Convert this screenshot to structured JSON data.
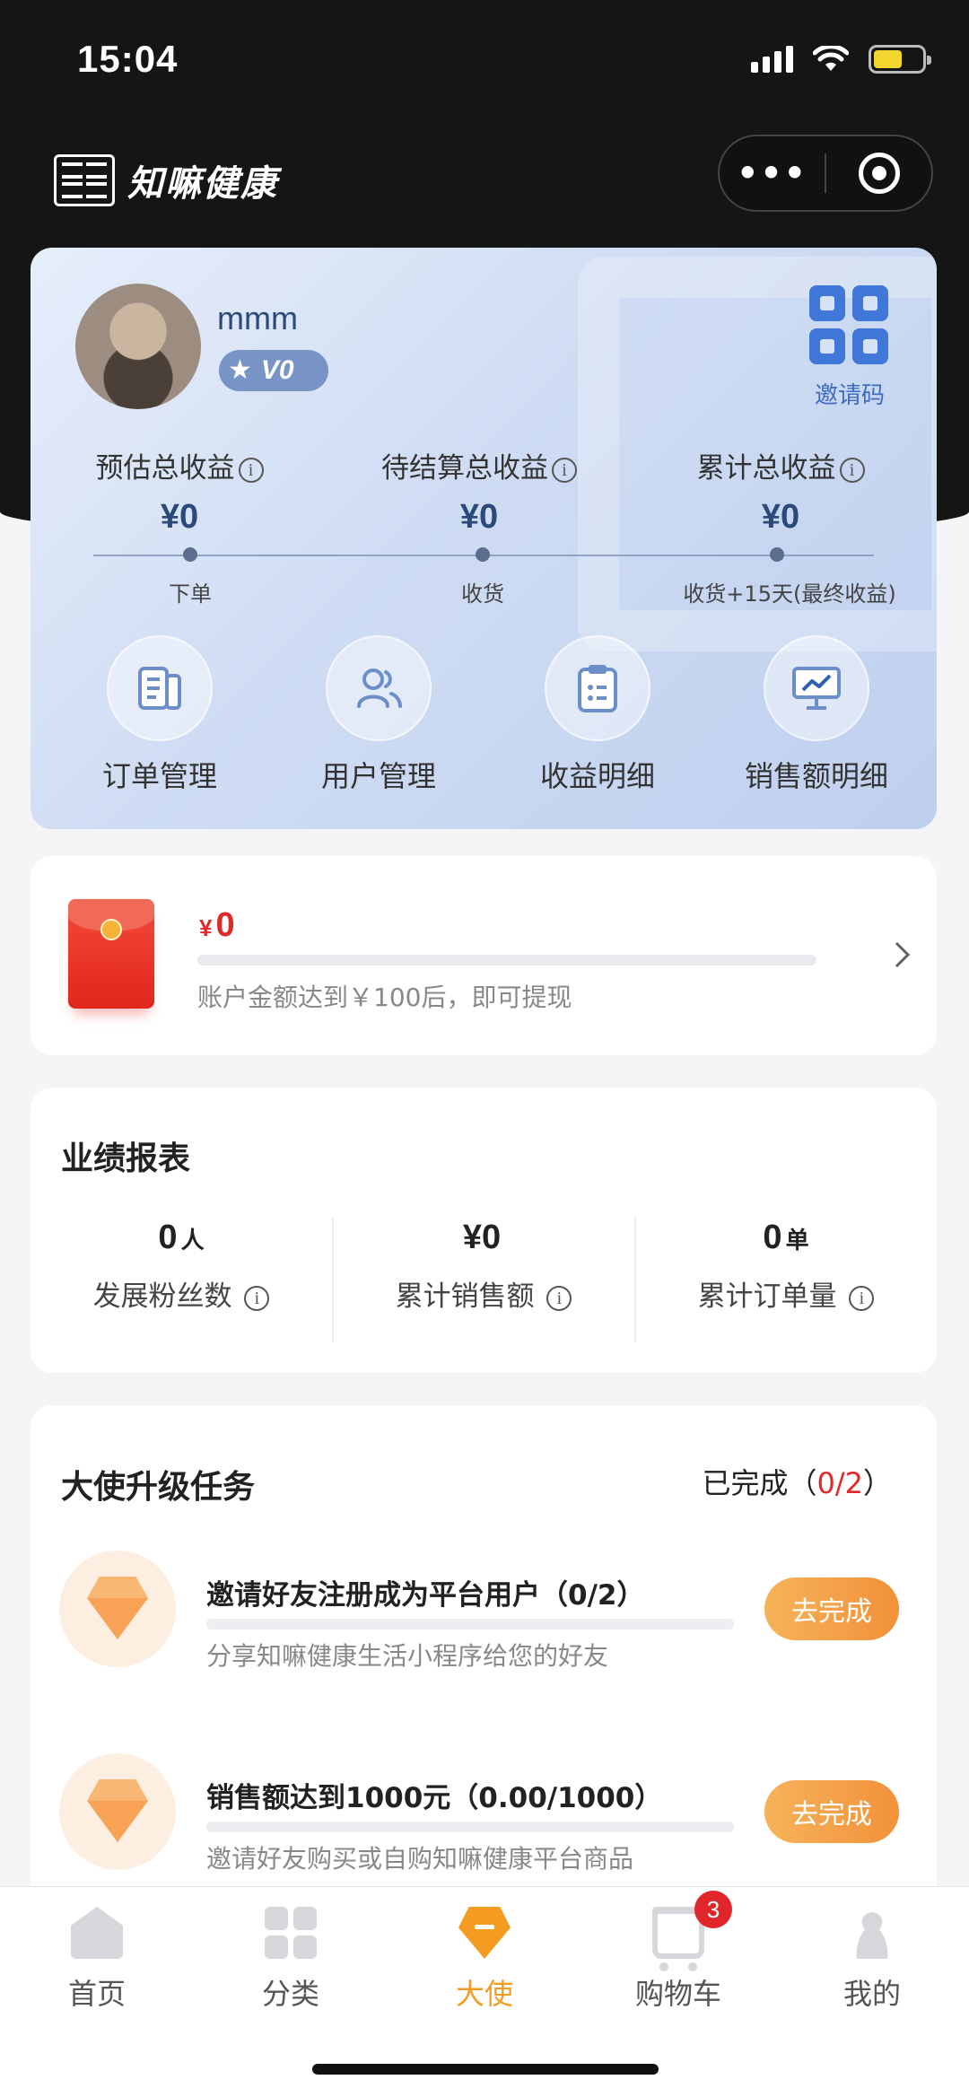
{
  "status_bar": {
    "time": "15:04"
  },
  "header": {
    "app_name": "知嘛健康",
    "more_glyph": "•••"
  },
  "profile": {
    "username": "mmm",
    "level": "V0",
    "qr_label": "邀请码"
  },
  "earnings": [
    {
      "label": "预估总收益",
      "value": "¥0",
      "stage": "下单"
    },
    {
      "label": "待结算总收益",
      "value": "¥0",
      "stage": "收货"
    },
    {
      "label": "累计总收益",
      "value": "¥0",
      "stage": "收货+15天(最终收益)"
    }
  ],
  "info_glyph": "i",
  "hero_actions": [
    {
      "label": "订单管理",
      "icon": "order-doc-icon"
    },
    {
      "label": "用户管理",
      "icon": "users-icon"
    },
    {
      "label": "收益明细",
      "icon": "clipboard-icon"
    },
    {
      "label": "销售额明细",
      "icon": "chart-board-icon"
    }
  ],
  "wallet": {
    "currency": "¥",
    "amount": "0",
    "tip": "账户金额达到￥100后，即可提现",
    "progress": 0
  },
  "report": {
    "title": "业绩报表",
    "stats": [
      {
        "value": "0",
        "unit": "人",
        "label": "发展粉丝数"
      },
      {
        "value": "¥0",
        "unit": "",
        "label": "累计销售额"
      },
      {
        "value": "0",
        "unit": "单",
        "label": "累计订单量"
      }
    ]
  },
  "tasks": {
    "title": "大使升级任务",
    "done_prefix": "已完成（",
    "done_count": "0/2",
    "done_suffix": "）",
    "items": [
      {
        "title": "邀请好友注册成为平台用户（0/2）",
        "desc": "分享知嘛健康生活小程序给您的好友",
        "button": "去完成",
        "progress": 0
      },
      {
        "title": "销售额达到1000元（0.00/1000）",
        "desc": "邀请好友购买或自购知嘛健康平台商品",
        "button": "去完成",
        "progress": 0
      }
    ]
  },
  "tabbar": {
    "items": [
      {
        "label": "首页",
        "icon": "home-icon"
      },
      {
        "label": "分类",
        "icon": "category-icon"
      },
      {
        "label": "大使",
        "icon": "ambassador-icon",
        "active": true
      },
      {
        "label": "购物车",
        "icon": "cart-icon",
        "badge": "3"
      },
      {
        "label": "我的",
        "icon": "profile-icon"
      }
    ]
  },
  "colors": {
    "accent": "#f39c1f",
    "price_red": "#e02a2a",
    "hero_blue": "#2b4a7a"
  }
}
